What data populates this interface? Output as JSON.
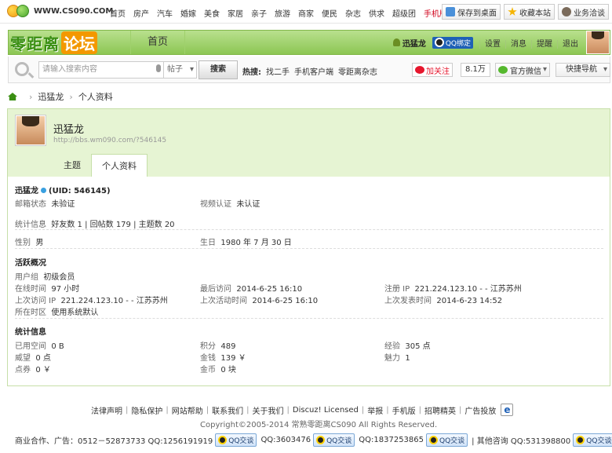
{
  "topbar": {
    "site": "WWW.CS090.COM",
    "nav": [
      "首页",
      "房产",
      "汽车",
      "婚嫁",
      "美食",
      "家居",
      "亲子",
      "旅游",
      "商家",
      "便民",
      "杂志",
      "供求",
      "超级团"
    ],
    "mobile": "手机版",
    "buttons": [
      "保存到桌面",
      "收藏本站",
      "业务洽谈"
    ]
  },
  "header": {
    "brand_part1": "零距离",
    "brand_part2": "论坛",
    "home_tab": "首页",
    "username": "迅猛龙",
    "qq_bind": "QQ绑定",
    "links": [
      "设置",
      "消息",
      "提醒",
      "退出"
    ]
  },
  "search": {
    "placeholder": "请输入搜索内容",
    "scope": "帖子",
    "button": "搜索",
    "hot_label": "热搜:",
    "hot_items": [
      "找二手",
      "手机客户端",
      "零距离杂志"
    ],
    "follow": "加关注",
    "follow_count": "8.1万",
    "wechat": "官方微信",
    "quick_nav": "快捷导航"
  },
  "breadcrumb": [
    "迅猛龙",
    "个人资料"
  ],
  "profile": {
    "name": "迅猛龙",
    "url": "http://bbs.wm090.com/?546145",
    "tabs": [
      "主题",
      "个人资料"
    ],
    "uid_line": "(UID: 546145)",
    "email_label": "邮箱状态",
    "email_value": "未验证",
    "video_label": "视频认证",
    "video_value": "未认证",
    "stats_label": "统计信息",
    "friends": "好友数 1",
    "replies": "回帖数 179",
    "threads": "主题数 20",
    "gender_label": "性别",
    "gender_value": "男",
    "birthday_label": "生日",
    "birthday_value": "1980 年 7 月 30 日",
    "activity_title": "活跃概况",
    "group_label": "用户组",
    "group_value": "初级会员",
    "online_label": "在线时间",
    "online_value": "97 小时",
    "last_visit_label": "最后访问",
    "last_visit_value": "2014-6-25 16:10",
    "reg_ip_label": "注册 IP",
    "reg_ip_value": "221.224.123.10 - - 江苏苏州",
    "last_ip_label": "上次访问 IP",
    "last_ip_value": "221.224.123.10 - - 江苏苏州",
    "last_active_label": "上次活动时间",
    "last_active_value": "2014-6-25 16:10",
    "last_post_label": "上次发表时间",
    "last_post_value": "2014-6-23 14:52",
    "tz_label": "所在时区",
    "tz_value": "使用系统默认",
    "stats_title": "统计信息",
    "space_label": "已用空间",
    "space_value": "0 B",
    "points_label": "积分",
    "points_value": "489",
    "exp_label": "经验",
    "exp_value": "305 点",
    "prestige_label": "威望",
    "prestige_value": "0 点",
    "money_label": "金钱",
    "money_value": "139 ￥",
    "charm_label": "魅力",
    "charm_value": "1",
    "coupon_label": "点券",
    "coupon_value": "0 ￥",
    "gold_label": "金币",
    "gold_value": "0 块"
  },
  "footer": {
    "links": [
      "法律声明",
      "隐私保护",
      "网站帮助",
      "联系我们",
      "关于我们",
      "Discuz! Licensed",
      "举报",
      "手机版",
      "招聘精英",
      "广告投放"
    ],
    "copyright": "Copyright©2005-2014  常熟零距离CS090 All Rights Reserved.",
    "contact_prefix": "商业合作、广告：0512－52873733 QQ:1256191919",
    "qq2": "QQ:3603476",
    "qq3": "QQ:1837253865",
    "other": "| 其他咨询 QQ:531398800",
    "qq_btn": "QQ交谈"
  }
}
